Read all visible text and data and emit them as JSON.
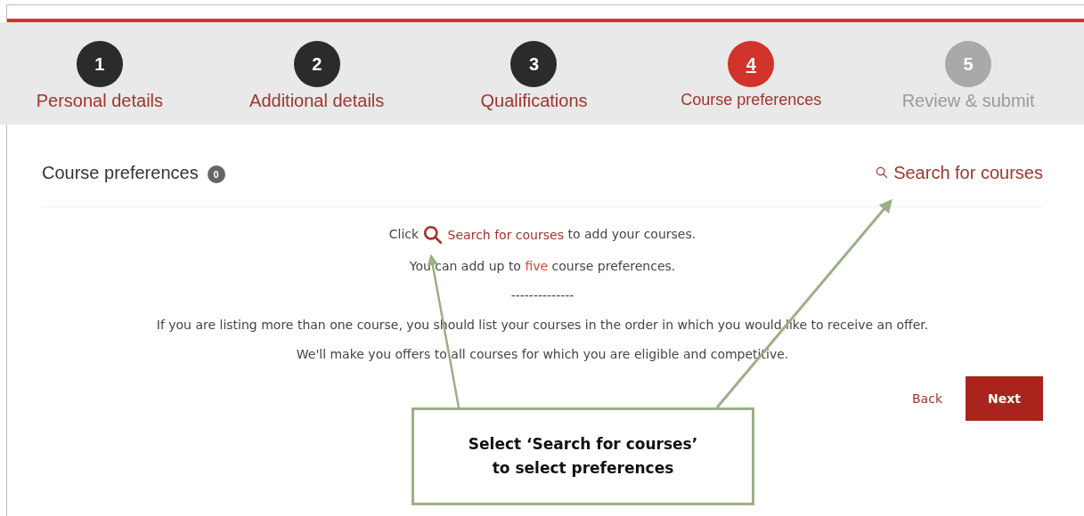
{
  "steps": [
    {
      "number": "1",
      "label": "Personal details",
      "selected": false,
      "disabled": false
    },
    {
      "number": "2",
      "label": "Additional details",
      "selected": false,
      "disabled": false
    },
    {
      "number": "3",
      "label": "Qualifications",
      "selected": false,
      "disabled": false
    },
    {
      "number": "4",
      "label": "Course preferences",
      "selected": true,
      "disabled": false
    },
    {
      "number": "5",
      "label": "Review & submit",
      "selected": false,
      "disabled": true
    }
  ],
  "section": {
    "title": "Course preferences",
    "count": "0",
    "search_link": "Search for courses"
  },
  "instructions": {
    "click_before": "Click",
    "click_link": "Search for courses",
    "click_after": "to add your courses.",
    "limit_before": "You can add up to ",
    "limit_highlight": "five",
    "limit_after": " course preferences.",
    "separator": "--------------",
    "order_note": "If you are listing more than one course, you should list your courses in the order in which you would like to receive an offer.",
    "offers_note": "We'll make you offers to all courses for which you are eligible and competitive."
  },
  "buttons": {
    "back": "Back",
    "next": "Next"
  },
  "callout": {
    "lines": [
      "Select ‘Search for courses’",
      "to select preferences"
    ]
  }
}
